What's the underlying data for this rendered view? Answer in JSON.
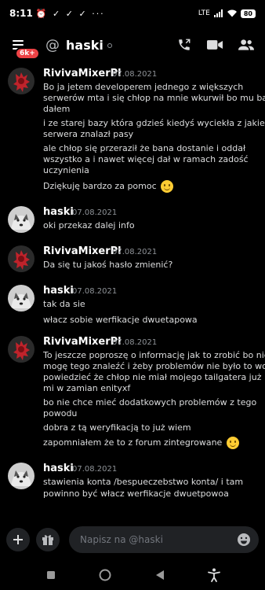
{
  "status_bar": {
    "time": "8:11",
    "notif_icons": "⏰ ✓ ✓ ✓ ···",
    "network": "LTE",
    "battery": "80"
  },
  "header": {
    "unread_badge": "6k+",
    "at_symbol": "@",
    "channel_name": "haski",
    "icons": [
      "menu-icon",
      "phone-icon",
      "video-icon",
      "people-icon"
    ]
  },
  "messages": [
    {
      "author": "RivivaMixerPl",
      "date": "07.08.2021",
      "lines": [
        "Bo ja jetem developerem jednego z większych",
        "serwerów mta i się chłop na mnie wkurwił bo mu bana",
        "dałem",
        "i ze starej bazy która gdzieś kiedyś wyciekła z jakiegoś",
        "serwera znalazł pasy",
        "ale chłop się przeraził że bana dostanie i oddał",
        "wszystko a i nawet więcej dał w ramach zadość",
        "uczynienia",
        "Dziękuję bardzo za pomoc"
      ]
    },
    {
      "author": "haski",
      "date": "07.08.2021",
      "lines": [
        "oki przekaz dalej info"
      ]
    },
    {
      "author": "RivivaMixerPl",
      "date": "07.08.2021",
      "lines": [
        "Da się tu jakoś hasło zmienić?"
      ]
    },
    {
      "author": "haski",
      "date": "07.08.2021",
      "lines": [
        "tak da sie",
        "włacz sobie werfikacje dwuetapowa"
      ]
    },
    {
      "author": "RivivaMixerPl",
      "date": "07.08.2021",
      "lines": [
        "To jeszcze poproszę o informację jak to zrobić bo nie",
        "mogę tego znaleźć i żeby problemów nie było to wolę",
        "powiedzieć że chłop nie miał mojego tailgatera już i dał",
        "mi w zamian enityxf",
        "bo nie chce mieć dodatkowych problemów z tego",
        "powodu",
        "dobra z tą weryfikacją to już wiem",
        "zapomniałem że to z forum zintegrowane"
      ]
    },
    {
      "author": "haski",
      "date": "07.08.2021",
      "lines": [
        "stawienia konta /bespueczebstwo konta/ i tam",
        "powinno być włacz werfikacje dwuetpowoa"
      ]
    }
  ],
  "composer": {
    "placeholder": "Napisz na @haski",
    "icons": [
      "plus-icon",
      "gift-icon",
      "emoji-icon"
    ]
  },
  "nav_bar": {
    "icons": [
      "recents-square-icon",
      "home-circle-icon",
      "back-triangle-icon",
      "accessibility-icon"
    ]
  }
}
